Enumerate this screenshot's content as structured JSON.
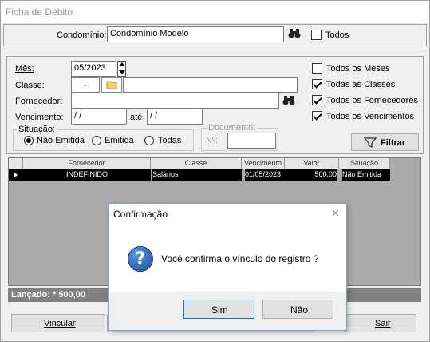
{
  "window": {
    "title": "Ficha de Débito"
  },
  "top": {
    "condominio_label": "Condomínio:",
    "condominio_value": "Condomínio Modelo",
    "todos_label": "Todos",
    "todos_checked": false
  },
  "filters": {
    "mes_label": "Mês:",
    "mes_value": "05/2023",
    "classe_label": "Classe:",
    "classe_code": ".",
    "classe_desc": "",
    "fornecedor_label": "Fornecedor:",
    "fornecedor_value": "",
    "vencimento_label": "Vencimento:",
    "venc_de": " / /",
    "ate_label": "até",
    "venc_ate": " / /",
    "situacao_label": "Situação:",
    "situacao_options": [
      "Não Emitida",
      "Emitida",
      "Todas"
    ],
    "situacao_selected": "Não Emitida",
    "documento_label": "Documento:",
    "numero_label": "Nº:",
    "numero_value": "",
    "checks": [
      {
        "label": "Todos os Meses",
        "checked": false
      },
      {
        "label": "Todas as Classes",
        "checked": true
      },
      {
        "label": "Todos os Fornecedores",
        "checked": true
      },
      {
        "label": "Todos os Vencimentos",
        "checked": true
      }
    ],
    "filtrar_label": "Filtrar"
  },
  "grid": {
    "columns": [
      "Fornecedor",
      "Classe",
      "Vencimento",
      "Valor",
      "Situação"
    ],
    "rows": [
      [
        "INDEFINIDO",
        "Salários",
        "01/05/2023",
        "500,00",
        "Não Emitida"
      ]
    ]
  },
  "footer": {
    "lancado": "Lançado: * 500,00",
    "vincular_label": "Vincular",
    "sair_label": "Sair"
  },
  "dialog": {
    "title": "Confirmação",
    "message": "Você confirma o vínculo do registro ?",
    "sim_label": "Sim",
    "nao_label": "Não"
  }
}
